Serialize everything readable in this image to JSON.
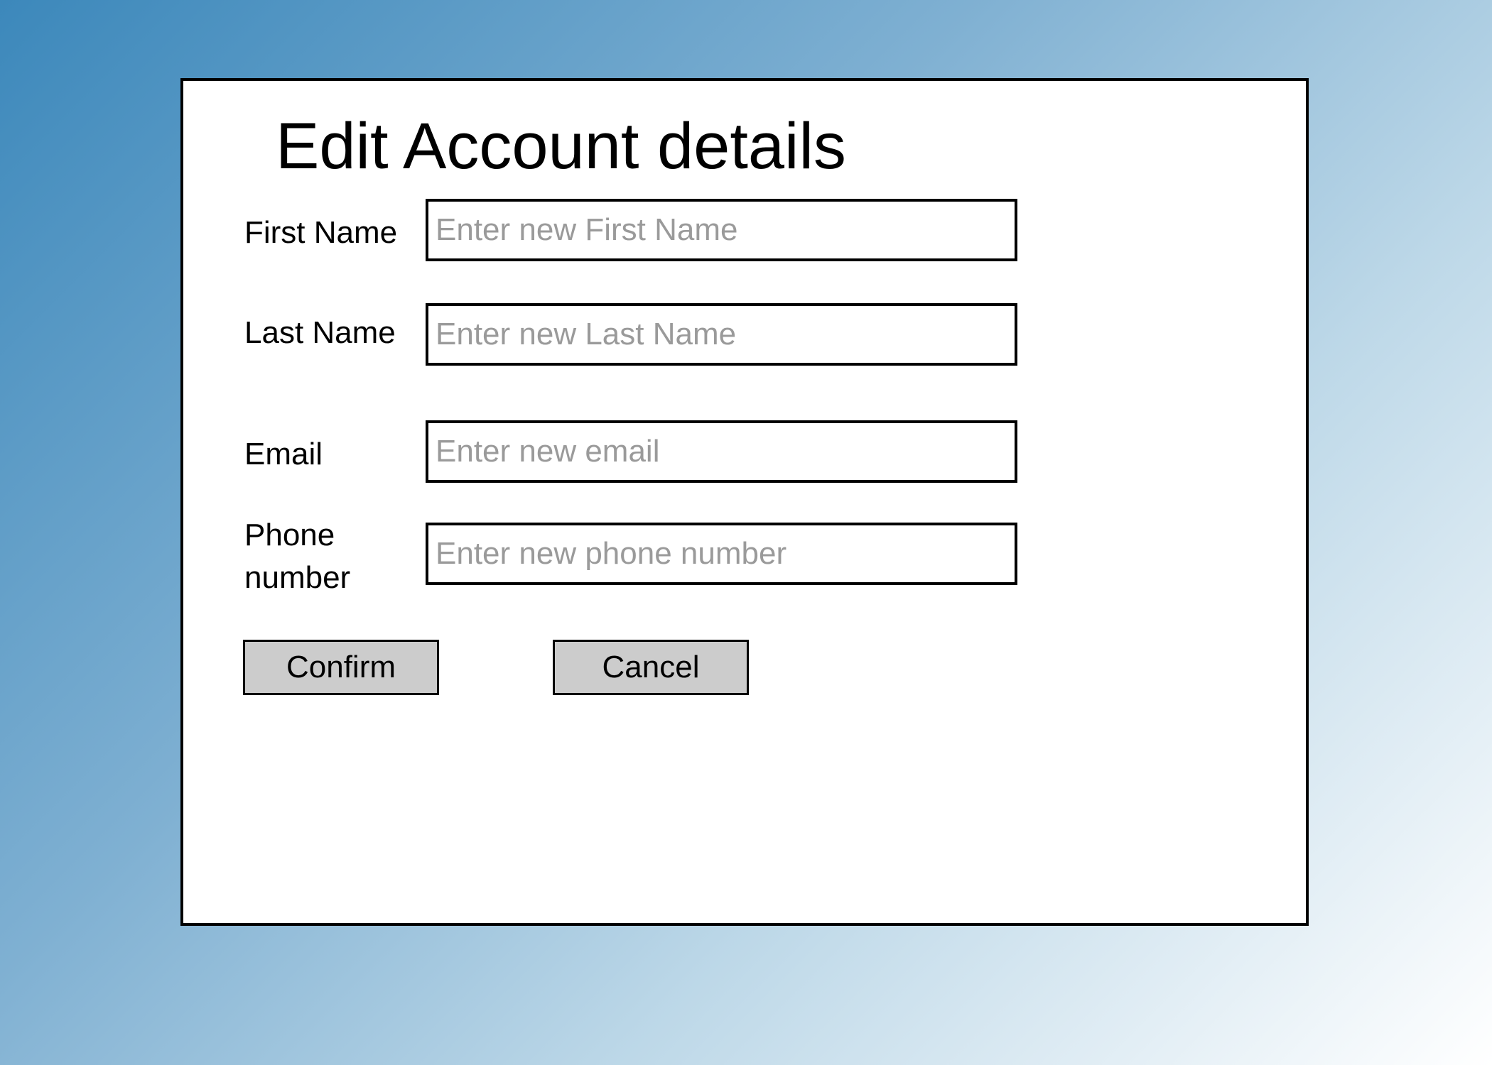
{
  "dialog": {
    "title": "Edit Account details",
    "fields": [
      {
        "label": "First Name",
        "placeholder": "Enter new First Name",
        "value": ""
      },
      {
        "label": "Last Name",
        "placeholder": "Enter new Last Name",
        "value": ""
      },
      {
        "label": "Email",
        "placeholder": "Enter new email",
        "value": ""
      },
      {
        "label": "Phone number",
        "placeholder": "Enter new phone number",
        "value": ""
      }
    ],
    "buttons": {
      "confirm_label": "Confirm",
      "cancel_label": "Cancel"
    }
  },
  "colors": {
    "background_gradient": [
      "#3c88bb",
      "#7fb0d2",
      "#bdd8e8",
      "#ffffff"
    ],
    "dialog_background": "#ffffff",
    "border": "#000000",
    "placeholder_text": "#9a9a9a",
    "button_background": "#cccccc"
  }
}
